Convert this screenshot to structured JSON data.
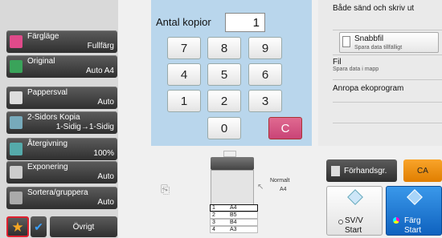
{
  "settings": [
    {
      "title": "Färgläge",
      "value": "Fullfärg",
      "icon": "color-mode-icon"
    },
    {
      "title": "Original",
      "value": "Auto  A4",
      "icon": "original-icon"
    },
    {
      "title": "Pappersval",
      "value": "Auto",
      "icon": "paper-select-icon"
    },
    {
      "title": "2-Sidors Kopia",
      "value": "1-Sidig→1-Sidig",
      "icon": "duplex-icon"
    },
    {
      "title": "Återgivning",
      "value": "100%",
      "icon": "ratio-icon"
    },
    {
      "title": "Exponering",
      "value": "Auto",
      "icon": "exposure-icon"
    },
    {
      "title": "Sortera/gruppera",
      "value": "Auto",
      "icon": "sort-icon"
    }
  ],
  "bottom_left": {
    "other_label": "Övrigt"
  },
  "keypad": {
    "copies_label": "Antal kopior",
    "copies_value": "1",
    "keys": [
      "7",
      "8",
      "9",
      "4",
      "5",
      "6",
      "1",
      "2",
      "3",
      "0"
    ],
    "clear_label": "C"
  },
  "right_panel": {
    "send_print": "Både sänd och skriv ut",
    "quick_file": "Snabbfil",
    "quick_file_sub": "Spara data tillfälligt",
    "file": "Fil",
    "file_sub": "Spara data i mapp",
    "eco": "Anropa ekoprogram"
  },
  "machine": {
    "output_label": "Normalt",
    "output_size": "A4",
    "trays": [
      {
        "num": "1",
        "size": "A4"
      },
      {
        "num": "2",
        "size": "B5"
      },
      {
        "num": "3",
        "size": "B4"
      },
      {
        "num": "4",
        "size": "A3"
      }
    ]
  },
  "actions": {
    "preview": "Förhandsgr.",
    "ca": "CA",
    "bw_start_1": "SV/V",
    "bw_start_2": "Start",
    "color_start_1": "Färg",
    "color_start_2": "Start"
  },
  "colors": {
    "accent_blue": "#1e7fd8",
    "clear_pink": "#d4507f",
    "ca_orange": "#f08c00",
    "keypad_bg": "#b9d6ec"
  }
}
